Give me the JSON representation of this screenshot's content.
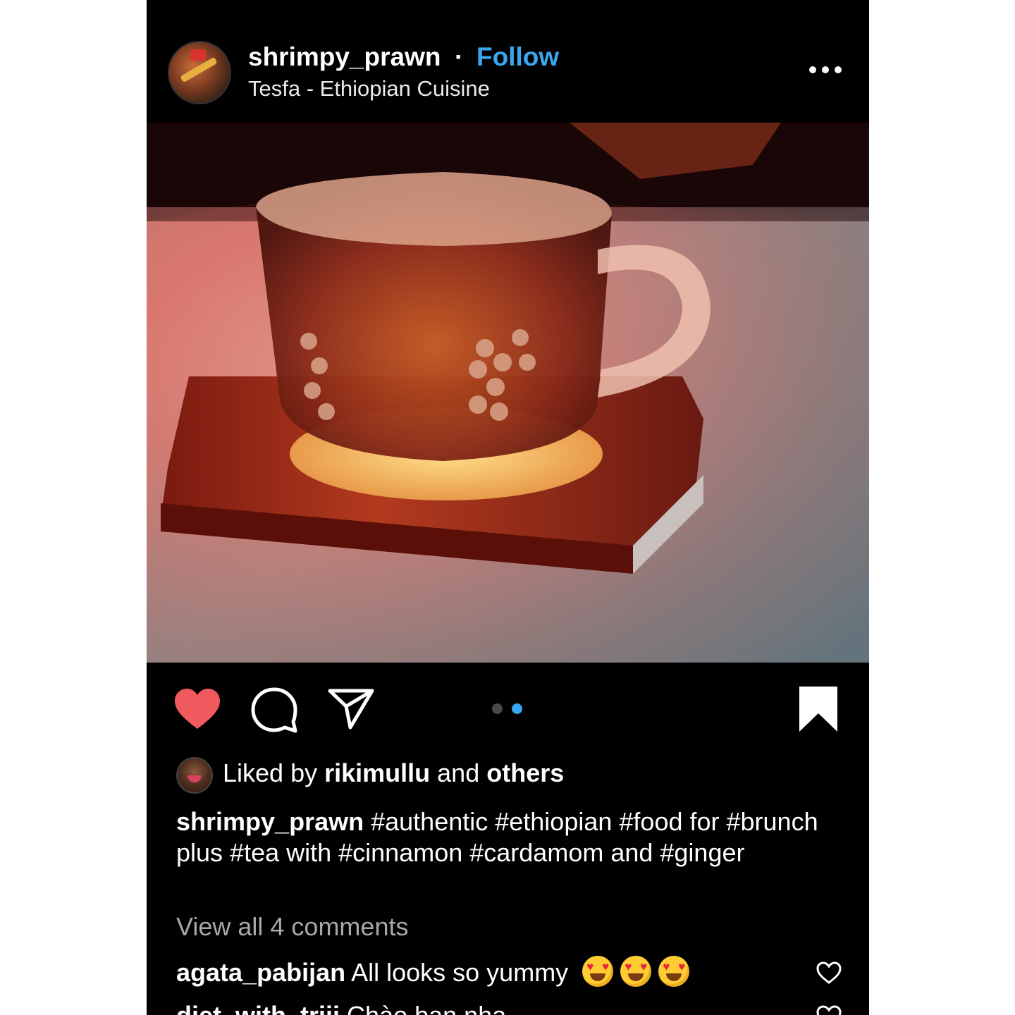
{
  "header": {
    "username": "shrimpy_prawn",
    "separator": "·",
    "follow_label": "Follow",
    "location": "Tesfa - Ethiopian Cuisine",
    "more_icon": "more-horizontal-icon"
  },
  "post": {
    "photo_description": "glass-tea-cup-on-wooden-coaster",
    "carousel": {
      "total": 2,
      "active": 2
    },
    "liked": true,
    "saved": true
  },
  "actions": {
    "like_icon": "heart-filled-icon",
    "comment_icon": "comment-icon",
    "share_icon": "send-icon",
    "save_icon": "bookmark-filled-icon"
  },
  "likes": {
    "prefix": "Liked by",
    "user": "rikimullu",
    "joiner": "and",
    "others": "others"
  },
  "caption": {
    "username": "shrimpy_prawn",
    "text": "#authentic #ethiopian #food for #brunch plus #tea with #cinnamon #cardamom and #ginger"
  },
  "view_all_comments": "View all 4 comments",
  "comments": [
    {
      "username": "agata_pabijan",
      "text": "All looks so yummy"
    },
    {
      "username": "diet_with_triii",
      "text": "Chào bạn nha"
    }
  ],
  "colors": {
    "background": "#000000",
    "accent_follow": "#3aa7f0",
    "like_red": "#f0595d",
    "muted_text": "#a8a8a8"
  }
}
